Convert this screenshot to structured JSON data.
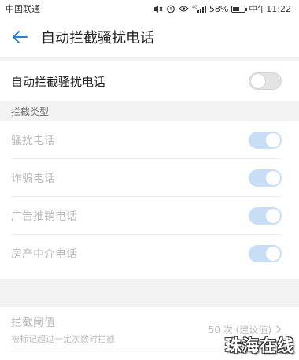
{
  "status_bar": {
    "carrier": "中国联通",
    "network": "4G",
    "battery_percent": "58%",
    "battery_level": 0.58,
    "time": "中午11:22",
    "icons": [
      "mute-icon",
      "alarm-icon",
      "eye-icon",
      "signal-icon",
      "battery-icon"
    ]
  },
  "header": {
    "back_icon": "arrow-left-icon",
    "title": "自动拦截骚扰电话"
  },
  "main_toggle": {
    "label": "自动拦截骚扰电话",
    "state": "off"
  },
  "section": {
    "title": "拦截类型"
  },
  "intercept_types": [
    {
      "label": "骚扰电话",
      "state": "on",
      "enabled": false
    },
    {
      "label": "诈骗电话",
      "state": "on",
      "enabled": false
    },
    {
      "label": "广告推销电话",
      "state": "on",
      "enabled": false
    },
    {
      "label": "房产中介电话",
      "state": "on",
      "enabled": false
    }
  ],
  "threshold": {
    "title": "拦截阈值",
    "subtitle": "被标记超过一定次数时拦截",
    "value": "50 次 (建议值)",
    "chevron_icon": "chevron-right-icon"
  },
  "watermark": "珠海在线",
  "colors": {
    "accent": "#2a7fd8",
    "disabled_toggle": "#c8ddf6",
    "disabled_text": "#b9b9b9"
  }
}
